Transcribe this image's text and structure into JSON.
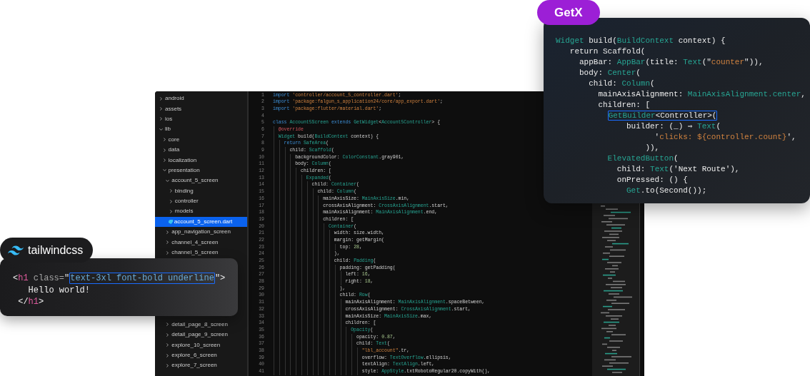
{
  "editor": {
    "file_tree": [
      {
        "name": "android",
        "kind": "folder",
        "expanded": false,
        "selected": false
      },
      {
        "name": "assets",
        "kind": "folder",
        "expanded": false,
        "selected": false
      },
      {
        "name": "ios",
        "kind": "folder",
        "expanded": false,
        "selected": false
      },
      {
        "name": "lib",
        "kind": "folder",
        "expanded": true,
        "selected": false,
        "children": [
          {
            "name": "core",
            "kind": "folder",
            "expanded": false,
            "selected": false
          },
          {
            "name": "data",
            "kind": "folder",
            "expanded": false,
            "selected": false
          },
          {
            "name": "localization",
            "kind": "folder",
            "expanded": false,
            "selected": false
          },
          {
            "name": "presentation",
            "kind": "folder",
            "expanded": true,
            "selected": false,
            "children": [
              {
                "name": "account_5_screen",
                "kind": "folder",
                "expanded": true,
                "selected": false,
                "children": [
                  {
                    "name": "binding",
                    "kind": "folder",
                    "expanded": false,
                    "selected": false
                  },
                  {
                    "name": "controller",
                    "kind": "folder",
                    "expanded": false,
                    "selected": false
                  },
                  {
                    "name": "models",
                    "kind": "folder",
                    "expanded": false,
                    "selected": false
                  },
                  {
                    "name": "account_5_screen.dart",
                    "kind": "file",
                    "selected": true
                  }
                ]
              },
              {
                "name": "app_navigation_screen",
                "kind": "folder",
                "expanded": false,
                "selected": false
              },
              {
                "name": "channel_4_screen",
                "kind": "folder",
                "expanded": false,
                "selected": false
              },
              {
                "name": "channel_5_screen",
                "kind": "folder",
                "expanded": false,
                "selected": false
              },
              {
                "name": "detail_page_8_screen",
                "kind": "folder",
                "expanded": false,
                "selected": false
              },
              {
                "name": "detail_page_9_screen",
                "kind": "folder",
                "expanded": false,
                "selected": false
              },
              {
                "name": "explore_10_screen",
                "kind": "folder",
                "expanded": false,
                "selected": false
              },
              {
                "name": "explore_6_screen",
                "kind": "folder",
                "expanded": false,
                "selected": false
              },
              {
                "name": "explore_7_screen",
                "kind": "folder",
                "expanded": false,
                "selected": false
              }
            ]
          }
        ]
      }
    ],
    "code_lines": [
      {
        "number": "1",
        "tokens": [
          {
            "kind": "keyword",
            "text": "import "
          },
          {
            "kind": "string",
            "text": "'controller/account_5_controller.dart'"
          },
          {
            "kind": "plain",
            "text": ";"
          }
        ]
      },
      {
        "number": "2",
        "tokens": [
          {
            "kind": "keyword",
            "text": "import "
          },
          {
            "kind": "string",
            "text": "'package:falgun_s_application24/core/app_export.dart'"
          },
          {
            "kind": "plain",
            "text": ";"
          }
        ]
      },
      {
        "number": "3",
        "tokens": [
          {
            "kind": "keyword",
            "text": "import "
          },
          {
            "kind": "string",
            "text": "'package:flutter/material.dart'"
          },
          {
            "kind": "plain",
            "text": ";"
          }
        ]
      },
      {
        "number": "4"
      },
      {
        "number": "5",
        "tokens": [
          {
            "kind": "keyword",
            "text": "class "
          },
          {
            "kind": "type",
            "text": "Account5Screen"
          },
          {
            "kind": "keyword",
            "text": " extends "
          },
          {
            "kind": "type",
            "text": "GetWidget"
          },
          {
            "kind": "plain",
            "text": "<"
          },
          {
            "kind": "type",
            "text": "Account5Controller"
          },
          {
            "kind": "plain",
            "text": "> {"
          }
        ]
      },
      {
        "number": "6",
        "tokens": [
          {
            "kind": "annotation",
            "text": "  @override"
          }
        ]
      },
      {
        "number": "7",
        "tokens": [
          {
            "kind": "type",
            "text": "  Widget"
          },
          {
            "kind": "plain",
            "text": " build("
          },
          {
            "kind": "type",
            "text": "BuildContext"
          },
          {
            "kind": "plain",
            "text": " context) {"
          }
        ]
      },
      {
        "number": "8",
        "tokens": [
          {
            "kind": "keyword",
            "text": "    return "
          },
          {
            "kind": "type",
            "text": "SafeArea"
          },
          {
            "kind": "plain",
            "text": "("
          }
        ]
      },
      {
        "number": "9",
        "tokens": [
          {
            "kind": "plain",
            "text": "      child: "
          },
          {
            "kind": "type",
            "text": "Scaffold"
          },
          {
            "kind": "plain",
            "text": "("
          }
        ]
      },
      {
        "number": "10",
        "tokens": [
          {
            "kind": "plain",
            "text": "        backgroundColor: "
          },
          {
            "kind": "type",
            "text": "ColorConstant"
          },
          {
            "kind": "plain",
            "text": ".gray901,"
          }
        ]
      },
      {
        "number": "11",
        "tokens": [
          {
            "kind": "plain",
            "text": "        body: "
          },
          {
            "kind": "type",
            "text": "Column"
          },
          {
            "kind": "plain",
            "text": "("
          }
        ]
      },
      {
        "number": "12",
        "tokens": [
          {
            "kind": "plain",
            "text": "          children: ["
          }
        ]
      },
      {
        "number": "13",
        "tokens": [
          {
            "kind": "type",
            "text": "            Expanded"
          },
          {
            "kind": "plain",
            "text": "("
          }
        ]
      },
      {
        "number": "14",
        "tokens": [
          {
            "kind": "plain",
            "text": "              child: "
          },
          {
            "kind": "type",
            "text": "Container"
          },
          {
            "kind": "plain",
            "text": "("
          }
        ]
      },
      {
        "number": "15",
        "tokens": [
          {
            "kind": "plain",
            "text": "                child: "
          },
          {
            "kind": "type",
            "text": "Column"
          },
          {
            "kind": "plain",
            "text": "("
          }
        ]
      },
      {
        "number": "16",
        "tokens": [
          {
            "kind": "plain",
            "text": "                  mainAxisSize: "
          },
          {
            "kind": "type",
            "text": "MainAxisSize"
          },
          {
            "kind": "plain",
            "text": ".min,"
          }
        ]
      },
      {
        "number": "17",
        "tokens": [
          {
            "kind": "plain",
            "text": "                  crossAxisAlignment: "
          },
          {
            "kind": "type",
            "text": "CrossAxisAlignment"
          },
          {
            "kind": "plain",
            "text": ".start,"
          }
        ]
      },
      {
        "number": "18",
        "tokens": [
          {
            "kind": "plain",
            "text": "                  mainAxisAlignment: "
          },
          {
            "kind": "type",
            "text": "MainAxisAlignment"
          },
          {
            "kind": "plain",
            "text": ".end,"
          }
        ]
      },
      {
        "number": "19",
        "tokens": [
          {
            "kind": "plain",
            "text": "                  children: ["
          }
        ]
      },
      {
        "number": "20",
        "tokens": [
          {
            "kind": "type",
            "text": "                    Container"
          },
          {
            "kind": "plain",
            "text": "("
          }
        ]
      },
      {
        "number": "21",
        "tokens": [
          {
            "kind": "plain",
            "text": "                      width: size.width,"
          }
        ]
      },
      {
        "number": "22",
        "tokens": [
          {
            "kind": "plain",
            "text": "                      margin: getMargin("
          }
        ]
      },
      {
        "number": "23",
        "tokens": [
          {
            "kind": "plain",
            "text": "                        top: "
          },
          {
            "kind": "number",
            "text": "28"
          },
          {
            "kind": "plain",
            "text": ","
          }
        ]
      },
      {
        "number": "24",
        "tokens": [
          {
            "kind": "plain",
            "text": "                      ),"
          }
        ]
      },
      {
        "number": "25",
        "tokens": [
          {
            "kind": "plain",
            "text": "                      child: "
          },
          {
            "kind": "type",
            "text": "Padding"
          },
          {
            "kind": "plain",
            "text": "("
          }
        ]
      },
      {
        "number": "26",
        "tokens": [
          {
            "kind": "plain",
            "text": "                        padding: getPadding("
          }
        ]
      },
      {
        "number": "27",
        "tokens": [
          {
            "kind": "plain",
            "text": "                          left: "
          },
          {
            "kind": "number",
            "text": "16"
          },
          {
            "kind": "plain",
            "text": ","
          }
        ]
      },
      {
        "number": "28",
        "tokens": [
          {
            "kind": "plain",
            "text": "                          right: "
          },
          {
            "kind": "number",
            "text": "18"
          },
          {
            "kind": "plain",
            "text": ","
          }
        ]
      },
      {
        "number": "29",
        "tokens": [
          {
            "kind": "plain",
            "text": "                        ),"
          }
        ]
      },
      {
        "number": "30",
        "tokens": [
          {
            "kind": "plain",
            "text": "                        child: "
          },
          {
            "kind": "type",
            "text": "Row"
          },
          {
            "kind": "plain",
            "text": "("
          }
        ]
      },
      {
        "number": "31",
        "tokens": [
          {
            "kind": "plain",
            "text": "                          mainAxisAlignment: "
          },
          {
            "kind": "type",
            "text": "MainAxisAlignment"
          },
          {
            "kind": "plain",
            "text": ".spaceBetween,"
          }
        ]
      },
      {
        "number": "32",
        "tokens": [
          {
            "kind": "plain",
            "text": "                          crossAxisAlignment: "
          },
          {
            "kind": "type",
            "text": "CrossAxisAlignment"
          },
          {
            "kind": "plain",
            "text": ".start,"
          }
        ]
      },
      {
        "number": "33",
        "tokens": [
          {
            "kind": "plain",
            "text": "                          mainAxisSize: "
          },
          {
            "kind": "type",
            "text": "MainAxisSize"
          },
          {
            "kind": "plain",
            "text": ".max,"
          }
        ]
      },
      {
        "number": "34",
        "tokens": [
          {
            "kind": "plain",
            "text": "                          children: ["
          }
        ]
      },
      {
        "number": "35",
        "tokens": [
          {
            "kind": "type",
            "text": "                            Opacity"
          },
          {
            "kind": "plain",
            "text": "("
          }
        ]
      },
      {
        "number": "36",
        "tokens": [
          {
            "kind": "plain",
            "text": "                              opacity: "
          },
          {
            "kind": "number",
            "text": "0.87"
          },
          {
            "kind": "plain",
            "text": ","
          }
        ]
      },
      {
        "number": "37",
        "tokens": [
          {
            "kind": "plain",
            "text": "                              child: "
          },
          {
            "kind": "type",
            "text": "Text"
          },
          {
            "kind": "plain",
            "text": "("
          }
        ]
      },
      {
        "number": "38",
        "tokens": [
          {
            "kind": "string",
            "text": "                                \"lbl_account\""
          },
          {
            "kind": "plain",
            "text": ".tr,"
          }
        ]
      },
      {
        "number": "39",
        "tokens": [
          {
            "kind": "plain",
            "text": "                                overflow: "
          },
          {
            "kind": "type",
            "text": "TextOverflow"
          },
          {
            "kind": "plain",
            "text": ".ellipsis,"
          }
        ]
      },
      {
        "number": "40",
        "tokens": [
          {
            "kind": "plain",
            "text": "                                textAlign: "
          },
          {
            "kind": "type",
            "text": "TextAlign"
          },
          {
            "kind": "plain",
            "text": ".left,"
          }
        ]
      },
      {
        "number": "41",
        "tokens": [
          {
            "kind": "plain",
            "text": "                                style: "
          },
          {
            "kind": "type",
            "text": "AppStyle"
          },
          {
            "kind": "plain",
            "text": ".txtRobotoRegular20.copyWith(),"
          }
        ]
      }
    ]
  },
  "getx_card": {
    "badge": "GetX",
    "code_lines": [
      [
        {
          "kind": "type",
          "text": "Widget"
        },
        {
          "kind": "plain",
          "text": " build("
        },
        {
          "kind": "type",
          "text": "BuildContext"
        },
        {
          "kind": "plain",
          "text": " context) {"
        }
      ],
      [
        {
          "kind": "plain",
          "text": "   return Scaffold("
        }
      ],
      [
        {
          "kind": "plain",
          "text": "     appBar: "
        },
        {
          "kind": "type",
          "text": "AppBar"
        },
        {
          "kind": "plain",
          "text": "(title: "
        },
        {
          "kind": "type",
          "text": "Text"
        },
        {
          "kind": "plain",
          "text": "(\""
        },
        {
          "kind": "string",
          "text": "counter"
        },
        {
          "kind": "plain",
          "text": "\")),"
        }
      ],
      [
        {
          "kind": "plain",
          "text": "     body: "
        },
        {
          "kind": "type",
          "text": "Center"
        },
        {
          "kind": "plain",
          "text": "("
        }
      ],
      [
        {
          "kind": "plain",
          "text": "       child: "
        },
        {
          "kind": "type",
          "text": "Column"
        },
        {
          "kind": "plain",
          "text": "("
        }
      ],
      [
        {
          "kind": "plain",
          "text": "         mainAxisAlignment: "
        },
        {
          "kind": "type",
          "text": "MainAxisAlignment.center"
        },
        {
          "kind": "plain",
          "text": ","
        }
      ],
      [
        {
          "kind": "plain",
          "text": "         children: ["
        }
      ],
      [
        {
          "kind": "highlight",
          "tokens": [
            {
              "kind": "type",
              "text": "           GetBuilder"
            },
            {
              "kind": "plain",
              "text": "<Controller>("
            }
          ]
        }
      ],
      [
        {
          "kind": "plain",
          "text": "               builder: (_) ⇒ "
        },
        {
          "kind": "type",
          "text": "Text"
        },
        {
          "kind": "plain",
          "text": "("
        }
      ],
      [
        {
          "kind": "plain",
          "text": "                     '"
        },
        {
          "kind": "string",
          "text": "clicks: ${controller.count}"
        },
        {
          "kind": "plain",
          "text": "',"
        }
      ],
      [
        {
          "kind": "plain",
          "text": "                   )),"
        }
      ],
      [
        {
          "kind": "type",
          "text": "           ElevatedButton"
        },
        {
          "kind": "plain",
          "text": "("
        }
      ],
      [
        {
          "kind": "plain",
          "text": "             child: "
        },
        {
          "kind": "type",
          "text": "Text"
        },
        {
          "kind": "plain",
          "text": "('Next Route'),"
        }
      ],
      [
        {
          "kind": "plain",
          "text": "             onPressed: () {"
        }
      ],
      [
        {
          "kind": "type",
          "text": "               Get"
        },
        {
          "kind": "plain",
          "text": ".to(Second());"
        }
      ]
    ]
  },
  "tailwind_card": {
    "badge": "tailwindcss",
    "code_lines": [
      [
        {
          "kind": "plain",
          "text": "<"
        },
        {
          "kind": "tag",
          "text": "h1"
        },
        {
          "kind": "attribute",
          "text": " class="
        },
        {
          "kind": "plain",
          "text": "\""
        },
        {
          "kind": "highlight",
          "tokens": [
            {
              "kind": "class_list",
              "text": "text-3xl font-bold underline"
            }
          ]
        },
        {
          "kind": "plain",
          "text": "\">"
        }
      ],
      [
        {
          "kind": "plain",
          "text": "   Hello world!"
        }
      ],
      [
        {
          "kind": "plain",
          "text": " </"
        },
        {
          "kind": "tag",
          "text": "h1"
        },
        {
          "kind": "plain",
          "text": ">"
        }
      ]
    ]
  }
}
